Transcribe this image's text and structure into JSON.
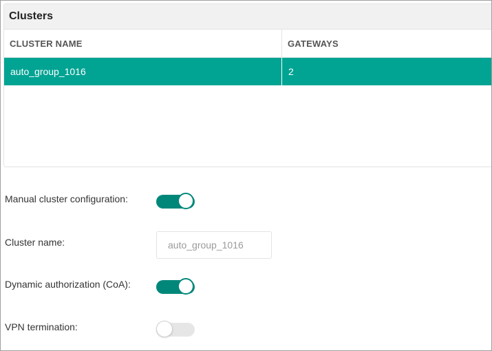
{
  "clusters_panel": {
    "title": "Clusters",
    "columns": [
      "CLUSTER NAME",
      "GATEWAYS"
    ],
    "rows": [
      {
        "cluster_name": "auto_group_1016",
        "gateways": "2",
        "selected": true
      }
    ]
  },
  "form": {
    "manual_config": {
      "label": "Manual cluster configuration:",
      "enabled": true
    },
    "cluster_name": {
      "label": "Cluster name:",
      "value": "auto_group_1016"
    },
    "dynamic_authorization": {
      "label": "Dynamic authorization (CoA):",
      "enabled": true
    },
    "vpn_termination": {
      "label": "VPN termination:",
      "enabled": false
    }
  },
  "colors": {
    "selected_row": "#01a393",
    "toggle_on": "#01877a",
    "toggle_off": "#e6e6e6"
  }
}
